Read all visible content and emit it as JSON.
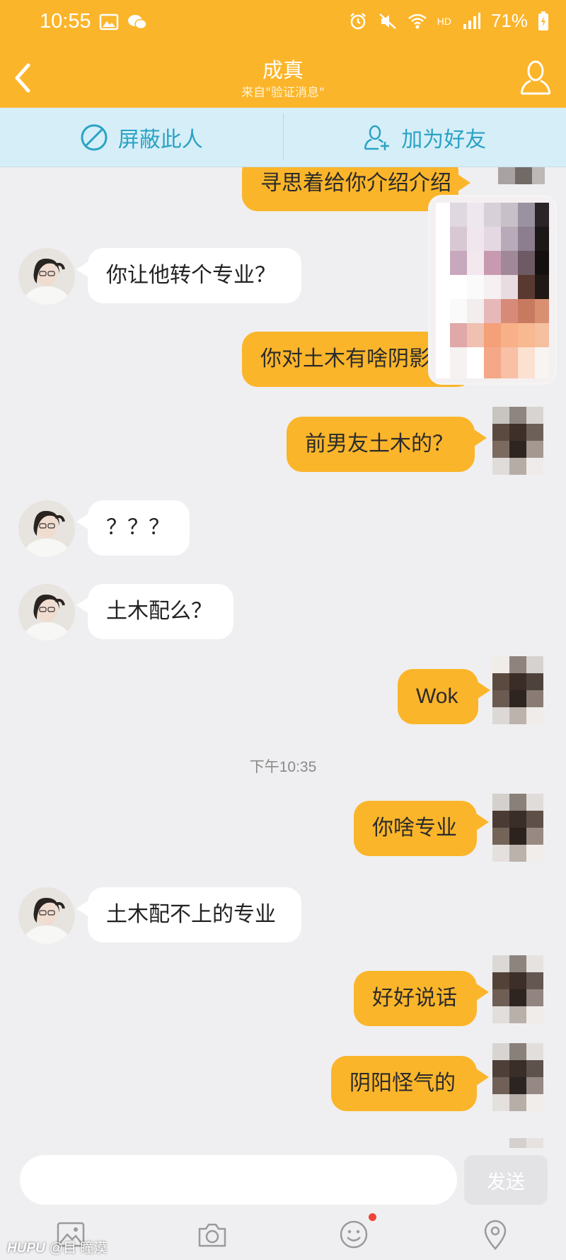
{
  "status_bar": {
    "time": "10:55",
    "battery": "71%",
    "network": "HD"
  },
  "nav": {
    "title": "成真",
    "subtitle": "来自\"验证消息\""
  },
  "actions": {
    "block": "屏蔽此人",
    "add_friend": "加为好友"
  },
  "messages": [
    {
      "from": "me",
      "text": "寻思着给你介绍介绍"
    },
    {
      "from": "them",
      "text": "你让他转个专业？"
    },
    {
      "from": "me",
      "text": "你对土木有啥阴影"
    },
    {
      "from": "me",
      "text": "前男友土木的？"
    },
    {
      "from": "them",
      "text": "？？？"
    },
    {
      "from": "them",
      "text": "土木配么？"
    },
    {
      "from": "me",
      "text": "Wok"
    },
    {
      "from": "me",
      "text": "你啥专业"
    },
    {
      "from": "them",
      "text": "土木配不上的专业"
    },
    {
      "from": "me",
      "text": "好好说话"
    },
    {
      "from": "me",
      "text": "阴阳怪气的"
    }
  ],
  "timestamp": "下午10:35",
  "composer": {
    "placeholder": "",
    "send_label": "发送"
  },
  "toolbar": {
    "icons": [
      "image-icon",
      "camera-icon",
      "emoji-icon",
      "location-icon"
    ]
  },
  "watermark": {
    "brand": "HUPU",
    "handle": "@目 瞳漠"
  },
  "colors": {
    "accent": "#fbb52a",
    "action_bar": "#d6eef8",
    "action_text": "#2aa3c4",
    "background": "#efeff1",
    "notify_dot": "#f0443a"
  }
}
